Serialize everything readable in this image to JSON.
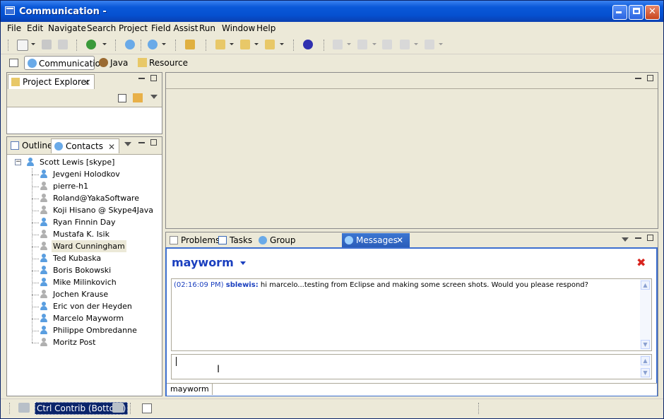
{
  "window": {
    "title": "Communication -"
  },
  "menu": [
    "File",
    "Edit",
    "Navigate",
    "Search",
    "Project",
    "Field Assist",
    "Run",
    "Window",
    "Help"
  ],
  "perspectives": {
    "communication": "Communication",
    "java": "Java",
    "resource": "Resource"
  },
  "project_explorer": {
    "tab": "Project Explorer"
  },
  "contacts_view": {
    "tabs": {
      "outline": "Outline",
      "contacts": "Contacts"
    },
    "root": "Scott Lewis [skype]",
    "contacts": [
      {
        "name": "Jevgeni Holodkov",
        "status": "online"
      },
      {
        "name": "pierre-h1",
        "status": "offline"
      },
      {
        "name": "Roland@YakaSoftware",
        "status": "offline"
      },
      {
        "name": "Koji Hisano @ Skype4Java",
        "status": "offline"
      },
      {
        "name": "Ryan Finnin Day",
        "status": "online"
      },
      {
        "name": "Mustafa K. Isik",
        "status": "offline"
      },
      {
        "name": "Ward Cunningham",
        "status": "offline"
      },
      {
        "name": "Ted Kubaska",
        "status": "online"
      },
      {
        "name": "Boris Bokowski",
        "status": "online"
      },
      {
        "name": "Mike Milinkovich",
        "status": "online"
      },
      {
        "name": "Jochen Krause",
        "status": "offline"
      },
      {
        "name": "Eric von der Heyden",
        "status": "online"
      },
      {
        "name": "Marcelo Mayworm",
        "status": "online"
      },
      {
        "name": "Philippe Ombredanne",
        "status": "online"
      },
      {
        "name": "Moritz Post",
        "status": "offline"
      }
    ]
  },
  "bottom_tabs": {
    "problems": "Problems",
    "tasks": "Tasks",
    "group": "Group Collaboration",
    "messages": "Messages"
  },
  "messages": {
    "chat_title": "mayworm",
    "log": {
      "time": "(02:16:09 PM)",
      "sender": "sblewis:",
      "text": "hi marcelo...testing from Eclipse and making some screen shots. Would you please respond?"
    },
    "input_value": "",
    "chat_tab": "mayworm"
  },
  "status": {
    "trim": "Ctrl Contrib (Bottom)"
  },
  "colors": {
    "title_blue": "#0550d0",
    "link_blue": "#1a3fbf",
    "close_red": "#d8241e"
  }
}
